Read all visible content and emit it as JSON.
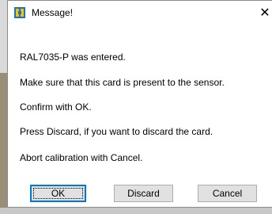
{
  "window": {
    "title": "Message!",
    "close_glyph": "✕"
  },
  "message": {
    "lines": [
      "RAL7035-P was entered.",
      "Make sure that this card is present to the sensor.",
      "Confirm with OK.",
      "Press Discard, if you want to discard the card.",
      "Abort calibration with Cancel."
    ]
  },
  "buttons": {
    "ok": "OK",
    "discard": "Discard",
    "cancel": "Cancel"
  },
  "colors": {
    "accent": "#0078d7",
    "icon_blue": "#1e6fc9",
    "icon_yellow": "#f2c500"
  },
  "icons": {
    "app": "app-window-icon",
    "close": "close-icon"
  }
}
